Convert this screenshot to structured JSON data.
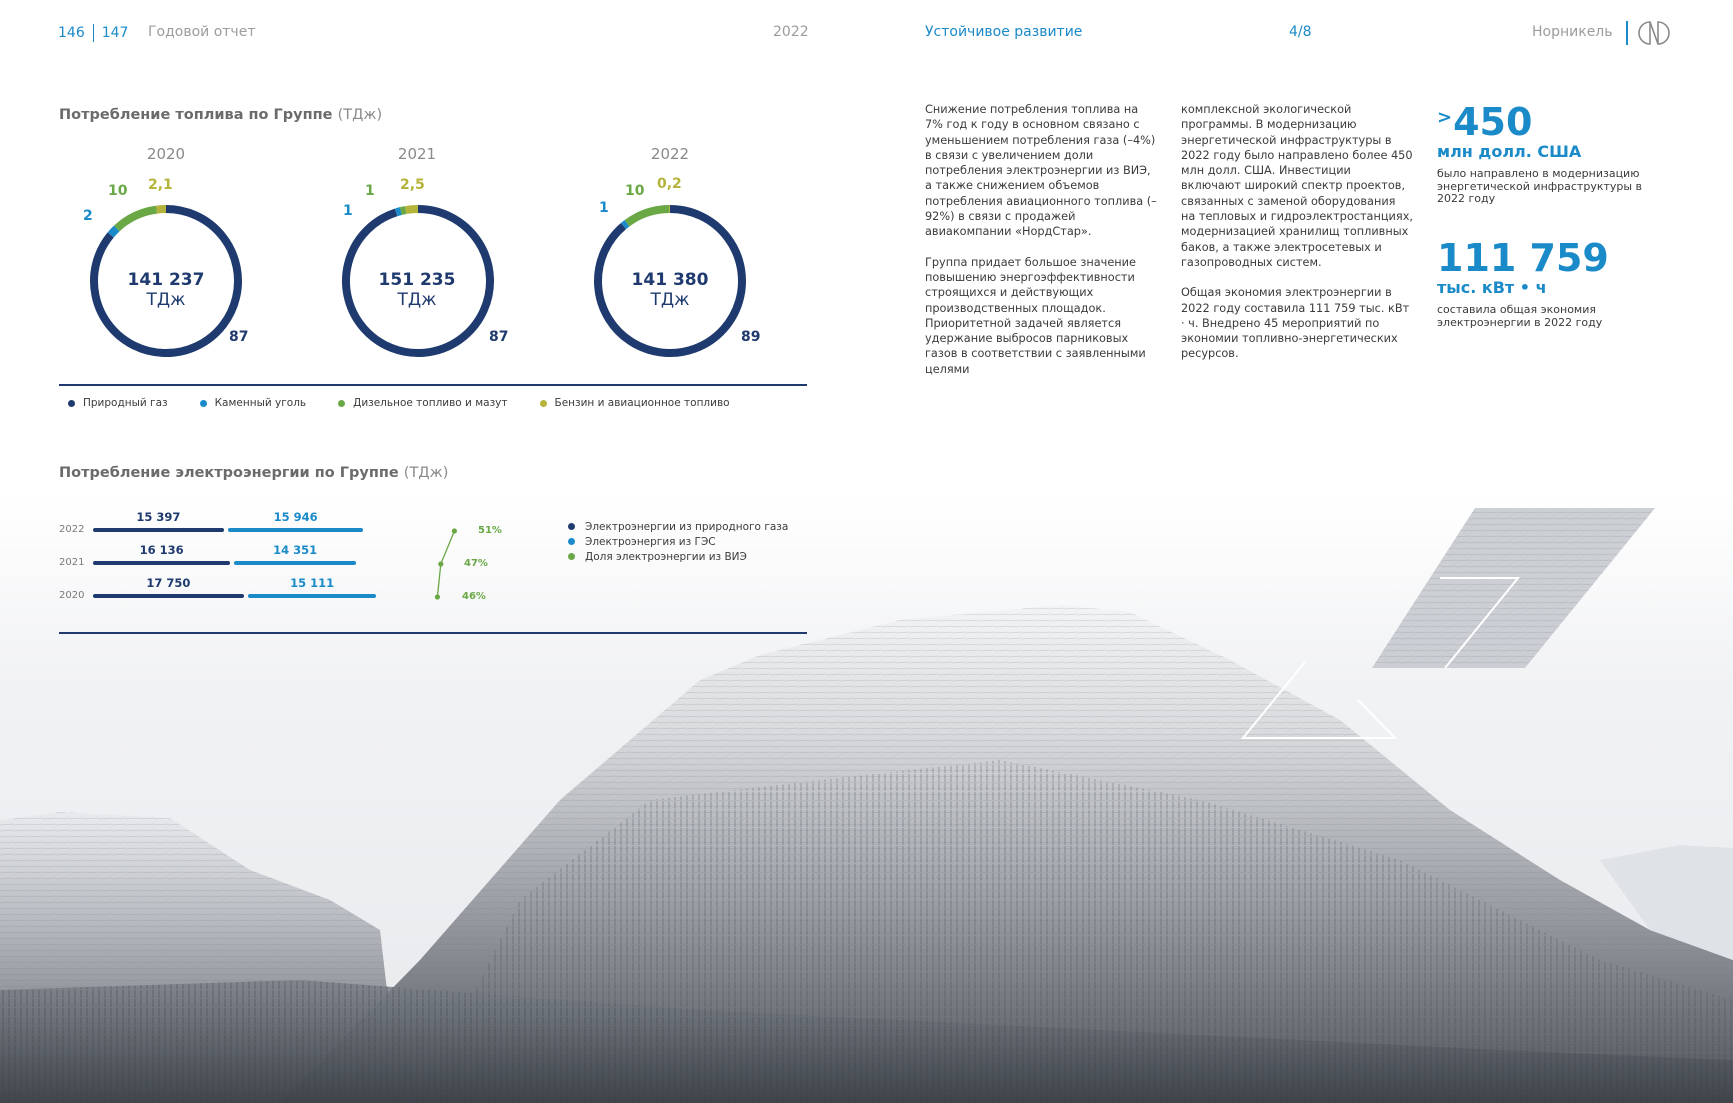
{
  "header": {
    "page_left": "146",
    "page_right": "147",
    "report_title": "Годовой отчет",
    "year": "2022",
    "section": "Устойчивое развитие",
    "counter": "4/8",
    "brand": "Норникель",
    "logo_icon": "nornickel-logo-icon"
  },
  "fuel": {
    "title": "Потребление топлива по Группе",
    "unit": "(ТДж)",
    "legend": [
      "Природный газ",
      "Каменный уголь",
      "Дизельное топливо и мазут",
      "Бензин и авиационное топливо"
    ],
    "colors": [
      "#1e3a6e",
      "#1a8ac9",
      "#6aa846",
      "#b4b43a"
    ],
    "donuts": [
      {
        "year": "2020",
        "total": "141 237",
        "unit": "ТДж",
        "gas": "87",
        "coal": "2",
        "diesel": "10",
        "petrol": "2,1"
      },
      {
        "year": "2021",
        "total": "151 235",
        "unit": "ТДж",
        "gas": "87",
        "coal": "1",
        "diesel": "1",
        "petrol": "2,5"
      },
      {
        "year": "2022",
        "total": "141 380",
        "unit": "ТДж",
        "gas": "89",
        "coal": "1",
        "diesel": "10",
        "petrol": "0,2"
      }
    ]
  },
  "electricity": {
    "title": "Потребление электроэнергии по Группе",
    "unit": "(ТДж)",
    "legend": [
      "Электроэнергии из природного газа",
      "Электроэнергия из ГЭС",
      "Доля электроэнергии из ВИЭ"
    ],
    "rows": [
      {
        "year": "2022",
        "gas": "15 397",
        "hydro": "15 946",
        "share": "51%"
      },
      {
        "year": "2021",
        "gas": "16 136",
        "hydro": "14 351",
        "share": "47%"
      },
      {
        "year": "2020",
        "gas": "17 750",
        "hydro": "15 111",
        "share": "46%"
      }
    ]
  },
  "chart_data": [
    {
      "type": "pie",
      "title": "Потребление топлива по Группе",
      "categories": [
        "Природный газ",
        "Каменный уголь",
        "Дизельное топливо и мазут",
        "Бензин и авиационное топливо"
      ],
      "series": [
        {
          "name": "2020",
          "values": [
            87,
            2,
            10,
            2.1
          ]
        },
        {
          "name": "2021",
          "values": [
            87,
            1,
            1,
            2.5
          ]
        },
        {
          "name": "2022",
          "values": [
            89,
            1,
            10,
            0.2
          ]
        }
      ]
    },
    {
      "type": "bar",
      "title": "Потребление электроэнергии по Группе",
      "categories": [
        "2022",
        "2021",
        "2020"
      ],
      "series": [
        {
          "name": "Электроэнергии из природного газа",
          "values": [
            15397,
            16136,
            17750
          ]
        },
        {
          "name": "Электроэнергия из ГЭС",
          "values": [
            15946,
            14351,
            15111
          ]
        },
        {
          "name": "Доля электроэнергии из ВИЭ",
          "values": [
            51,
            47,
            46
          ]
        }
      ]
    }
  ],
  "text": {
    "col1_p1": "Снижение потребления топлива на 7% год к году в основном связано с уменьшением потребления газа (–4%) в связи с увеличением доли потребления электроэнергии из ВИЭ, а также снижением объемов потребления авиационного топлива (–92%) в связи с продажей авиакомпании «НордСтар».",
    "col1_p2": "Группа придает большое значение повышению энергоэффективности строящихся и действующих производственных площадок. Приоритетной задачей является удержание выбросов парниковых газов в соответствии с заявленными целями",
    "col2_p1": "комплексной экологической программы. В модернизацию энергетической инфраструктуры в 2022 году было направлено более 450 млн долл. США. Инвестиции включают широкий спектр проектов, связанных с заменой оборудования на тепловых и гидроэлектростанциях, модернизацией хранилищ топливных баков, а также электросетевых и газопроводных систем.",
    "col2_p2": "Общая экономия электроэнергии в 2022 году составила 111 759 тыс. кВт · ч. Внедрено 45 мероприятий по экономии топливно-энергетических ресурсов."
  },
  "kpi": [
    {
      "prefix": ">",
      "value": "450",
      "unit": "млн долл. США",
      "desc": "было направлено в модернизацию энергетической инфраструктуры в 2022 году"
    },
    {
      "prefix": "",
      "value": "111 759",
      "unit": "тыс. кВт • ч",
      "desc": "составила общая экономия электроэнергии в 2022 году"
    }
  ]
}
